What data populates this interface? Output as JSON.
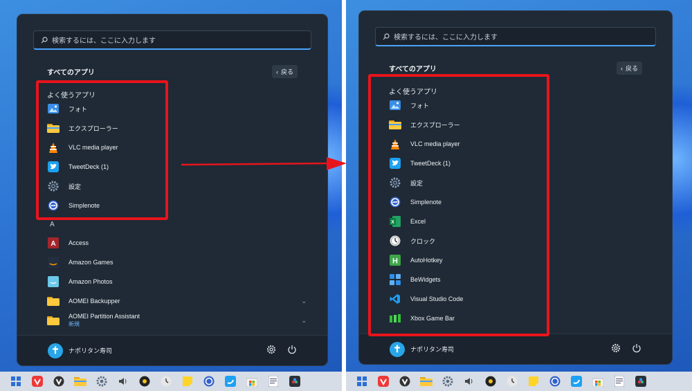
{
  "left": {
    "search_placeholder": "検索するには、ここに入力します",
    "all_apps_title": "すべてのアプリ",
    "back_label": "戻る",
    "frequent_title": "よく使うアプリ",
    "frequent": [
      {
        "label": "フォト",
        "icon": "photos-icon"
      },
      {
        "label": "エクスプローラー",
        "icon": "explorer-icon"
      },
      {
        "label": "VLC media player",
        "icon": "vlc-icon"
      },
      {
        "label": "TweetDeck (1)",
        "icon": "tweetdeck-icon"
      },
      {
        "label": "設定",
        "icon": "settings-icon"
      },
      {
        "label": "Simplenote",
        "icon": "simplenote-icon"
      }
    ],
    "letter_a": "A",
    "apps": [
      {
        "label": "Access",
        "icon": "access-icon"
      },
      {
        "label": "Amazon Games",
        "icon": "amazon-games-icon"
      },
      {
        "label": "Amazon Photos",
        "icon": "amazon-photos-icon"
      },
      {
        "label": "AOMEI Backupper",
        "icon": "folder-icon"
      },
      {
        "label": "AOMEI Partition Assistant",
        "icon": "folder-icon",
        "sub": "新規"
      }
    ],
    "user_name": "ナポリタン寿司"
  },
  "right": {
    "search_placeholder": "検索するには、ここに入力します",
    "all_apps_title": "すべてのアプリ",
    "back_label": "戻る",
    "frequent_title": "よく使うアプリ",
    "frequent": [
      {
        "label": "フォト",
        "icon": "photos-icon"
      },
      {
        "label": "エクスプローラー",
        "icon": "explorer-icon"
      },
      {
        "label": "VLC media player",
        "icon": "vlc-icon"
      },
      {
        "label": "TweetDeck (1)",
        "icon": "tweetdeck-icon"
      },
      {
        "label": "設定",
        "icon": "settings-icon"
      },
      {
        "label": "Simplenote",
        "icon": "simplenote-icon"
      },
      {
        "label": "Excel",
        "icon": "excel-icon"
      },
      {
        "label": "クロック",
        "icon": "clock-icon"
      },
      {
        "label": "AutoHotkey",
        "icon": "autohotkey-icon"
      },
      {
        "label": "BeWidgets",
        "icon": "bewidgets-icon"
      },
      {
        "label": "Visual Studio Code",
        "icon": "vscode-icon"
      },
      {
        "label": "Xbox Game Bar",
        "icon": "xbox-game-bar-icon"
      }
    ],
    "user_name": "ナポリタン寿司"
  },
  "taskbar_icons": [
    "start-icon",
    "vivaldi-icon",
    "vivaldi-snapshot-icon",
    "explorer-icon",
    "settings-icon",
    "volume-icon",
    "app-icon",
    "clock-icon",
    "sticky-notes-icon",
    "simplenote-icon",
    "tweetdeck-icon",
    "store-icon",
    "notepad-icon",
    "resolve-icon"
  ],
  "colors": {
    "accent": "#4aa3ff",
    "highlight": "#e8141c",
    "menu_bg": "#1f2a36"
  }
}
